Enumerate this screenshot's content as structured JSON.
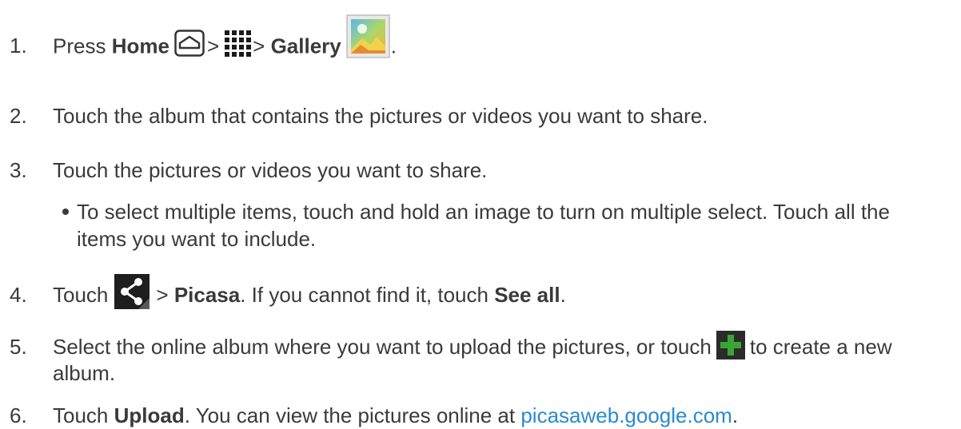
{
  "steps": [
    {
      "number": "1.",
      "parts": {
        "press": "Press",
        "home": "Home",
        "sep1": ">",
        "sep2": ">",
        "gallery": "Gallery",
        "end": "."
      }
    },
    {
      "number": "2.",
      "text": "Touch the album that contains the pictures or videos you want to share."
    },
    {
      "number": "3.",
      "text": "Touch the pictures or videos you want to share."
    },
    {
      "number": "4.",
      "parts": {
        "touch": "Touch",
        "sep": ">",
        "picasa": "Picasa",
        "mid": ". If you cannot find it, touch ",
        "see_all": "See all",
        "end": "."
      }
    },
    {
      "number": "5.",
      "parts": {
        "a": "Select the online album where you want to upload the pictures, or touch",
        "b": "to create a new",
        "c": "album."
      }
    },
    {
      "number": "6.",
      "parts": {
        "touch": "Touch",
        "upload": "Upload",
        "mid": ". You can view the pictures online at ",
        "link": "picasaweb.google.com",
        "end": "."
      }
    }
  ],
  "bullet": {
    "line1": "To select multiple items, touch and hold an image to turn on multiple select. Touch all the",
    "line2": "items you want to include."
  },
  "icons": [
    "home-icon",
    "apps-grid-icon",
    "gallery-icon",
    "share-icon",
    "plus-icon"
  ],
  "colors": {
    "text": "#3a3a3a",
    "link": "#2a8ad0",
    "plus": "#3aa534"
  }
}
